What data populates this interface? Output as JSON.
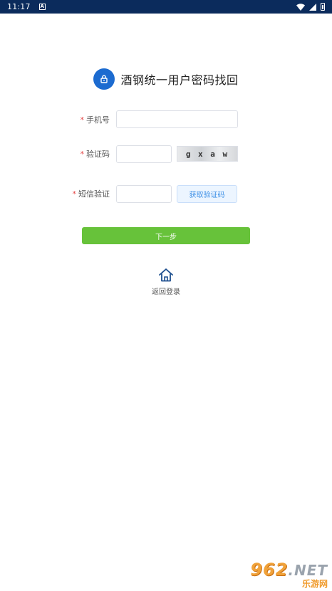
{
  "status_bar": {
    "time": "11:17",
    "notification_icon": "A"
  },
  "header": {
    "title": "酒钢统一用户密码找回",
    "icon": "lock-icon"
  },
  "form": {
    "phone": {
      "label": "手机号",
      "required_mark": "*",
      "value": ""
    },
    "captcha": {
      "label": "验证码",
      "required_mark": "*",
      "value": "",
      "image_text": "g x a w"
    },
    "sms": {
      "label": "短信验证",
      "required_mark": "*",
      "value": "",
      "button_label": "获取验证码"
    }
  },
  "actions": {
    "next_label": "下一步",
    "back_label": "返回登录"
  },
  "watermark": {
    "brand_number": "962",
    "brand_suffix": ".NET",
    "brand_cn": "乐游网"
  },
  "colors": {
    "status_bar": "#0b2b5c",
    "primary_blue": "#1c6bd0",
    "next_button_green": "#67c23a",
    "required_red": "#e54545"
  }
}
